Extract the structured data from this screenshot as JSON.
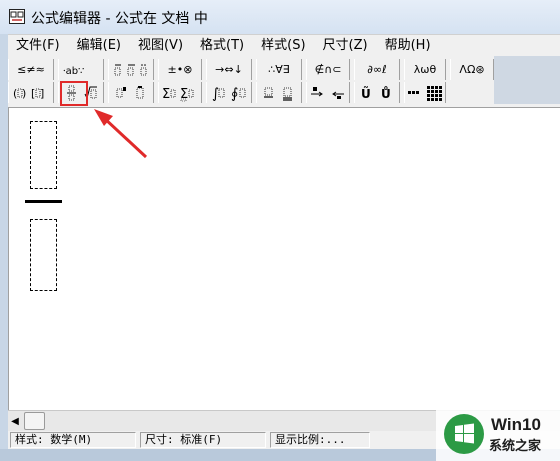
{
  "window": {
    "title": "公式编辑器 - 公式在 文档 中",
    "icon": "equation-editor-icon"
  },
  "menu": [
    {
      "id": "file",
      "label": "文件(F)"
    },
    {
      "id": "edit",
      "label": "编辑(E)"
    },
    {
      "id": "view",
      "label": "视图(V)"
    },
    {
      "id": "format",
      "label": "格式(T)"
    },
    {
      "id": "style",
      "label": "样式(S)"
    },
    {
      "id": "size",
      "label": "尺寸(Z)"
    },
    {
      "id": "help",
      "label": "帮助(H)"
    }
  ],
  "toolbar_symbols": [
    {
      "id": "relational",
      "label": "≤≠≈"
    },
    {
      "id": "spaces",
      "label": "⸱ab∵"
    },
    {
      "id": "embellishments",
      "label": "⸱̈ ⸱̇ ⸱̈"
    },
    {
      "id": "operators",
      "label": "±•⊗"
    },
    {
      "id": "arrows",
      "label": "→⇔↓"
    },
    {
      "id": "logic",
      "label": "∴∀∃"
    },
    {
      "id": "sets",
      "label": "∉∩⊂"
    },
    {
      "id": "misc",
      "label": "∂∞ℓ"
    },
    {
      "id": "greek-lower",
      "label": "λωθ"
    },
    {
      "id": "greek-upper",
      "label": "ΛΩ⊛"
    }
  ],
  "toolbar_templates": [
    {
      "id": "fences",
      "label": "(▯) [▯]"
    },
    {
      "id": "fractions-radicals",
      "label": "fraction-radical-icon"
    },
    {
      "id": "scripts",
      "label": "scripts-icon"
    },
    {
      "id": "summations",
      "label": "Σ▯ Σ▯"
    },
    {
      "id": "integrals",
      "label": "∫▯ ∮▯"
    },
    {
      "id": "underbars",
      "label": "underbar-overbar-icon"
    },
    {
      "id": "labeled-arrows",
      "label": "labeled-arrow-icon"
    },
    {
      "id": "products",
      "label": "Ũ Ů"
    },
    {
      "id": "matrices",
      "label": "matrix-icon"
    }
  ],
  "status": {
    "style": "样式: 数学(M)",
    "size": "尺寸: 标准(F)",
    "zoom": "显示比例:..."
  },
  "watermark": {
    "line1": "Win10",
    "line2": "系统之家",
    "logo": "windows-logo-icon",
    "color": "#2c9a45"
  },
  "highlight_color": "#e02a2a"
}
